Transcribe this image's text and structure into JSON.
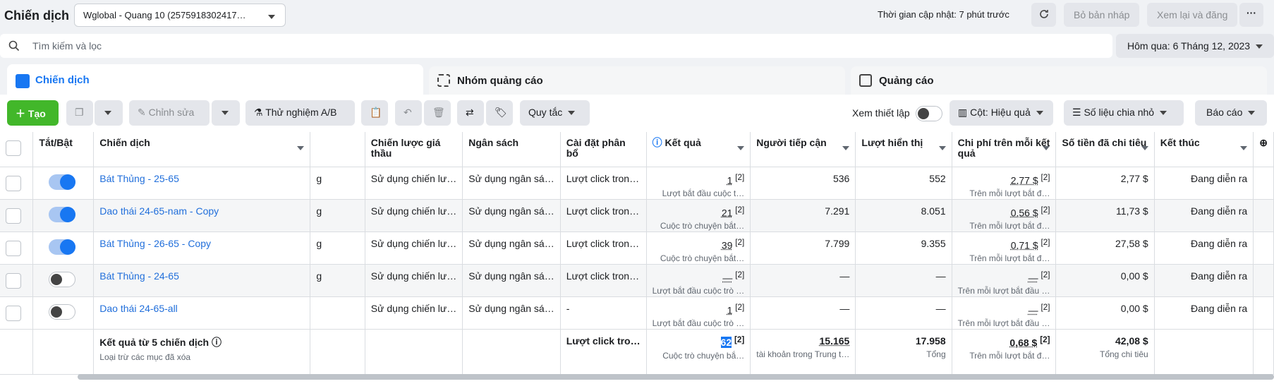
{
  "header": {
    "title": "Chiến dịch",
    "account": "Wglobal - Quang 10 (2575918302417…",
    "updated": "Thời gian cập nhật: 7 phút trước",
    "discard": "Bỏ bản nháp",
    "review": "Xem lại và đăng",
    "more": "···"
  },
  "search": {
    "placeholder": "Tìm kiếm và lọc"
  },
  "date": "Hôm qua: 6 Tháng 12, 2023",
  "tabs": [
    "Chiến dịch",
    "Nhóm quảng cáo",
    "Quảng cáo"
  ],
  "toolbar": {
    "create": "Tạo",
    "edit": "Chỉnh sửa",
    "ab": "Thử nghiệm A/B",
    "rules": "Quy tắc",
    "view_setup": "Xem thiết lập",
    "columns": "Cột: Hiệu quả",
    "breakdown": "Số liệu chia nhỏ",
    "reports": "Báo cáo"
  },
  "columns": [
    "Tắt/Bật",
    "Chiến dịch",
    "Chiến lược giá thầu",
    "Ngân sách",
    "Cài đặt phân bổ",
    "Kết quả",
    "Người tiếp cận",
    "Lượt hiển thị",
    "Chi phí trên mỗi kết quả",
    "Số tiền đã chi tiêu",
    "Kết thúc"
  ],
  "rows": [
    {
      "on": true,
      "name": "Bát Thủng - 25-65",
      "g": "g",
      "bid": "Sử dụng chiến lư…",
      "budget": "Sử dụng ngân sá…",
      "attr": "Lượt click tron…",
      "result": "1",
      "result_sub": "Lượt bắt đầu cuộc t…",
      "reach": "536",
      "impr": "552",
      "cpr": "2,77 $",
      "cpr_sub": "Trên mỗi lượt bắt đ…",
      "spent": "2,77 $",
      "end": "Đang diễn ra"
    },
    {
      "on": true,
      "name": "Dao thái 24-65-nam - Copy",
      "g": "g",
      "bid": "Sử dụng chiến lư…",
      "budget": "Sử dụng ngân sá…",
      "attr": "Lượt click tron…",
      "result": "21",
      "result_sub": "Cuộc trò chuyện bắt…",
      "reach": "7.291",
      "impr": "8.051",
      "cpr": "0,56 $",
      "cpr_sub": "Trên mỗi lượt bắt đ…",
      "spent": "11,73 $",
      "end": "Đang diễn ra"
    },
    {
      "on": true,
      "name": "Bát Thủng - 26-65 - Copy",
      "g": "g",
      "bid": "Sử dụng chiến lư…",
      "budget": "Sử dụng ngân sá…",
      "attr": "Lượt click tron…",
      "result": "39",
      "result_sub": "Cuộc trò chuyện bắt…",
      "reach": "7.799",
      "impr": "9.355",
      "cpr": "0,71 $",
      "cpr_sub": "Trên mỗi lượt bắt đ…",
      "spent": "27,58 $",
      "end": "Đang diễn ra"
    },
    {
      "on": false,
      "name": "Bát Thủng - 24-65",
      "g": "g",
      "bid": "Sử dụng chiến lư…",
      "budget": "Sử dụng ngân sá…",
      "attr": "Lượt click tron…",
      "result": "—",
      "result_sub": "Lượt bắt đầu cuộc trò …",
      "reach": "—",
      "impr": "—",
      "cpr": "—",
      "cpr_sub": "Trên mỗi lượt bắt đầu …",
      "spent": "0,00 $",
      "end": "Đang diễn ra"
    },
    {
      "on": false,
      "name": "Dao thái 24-65-all",
      "g": "",
      "bid": "Sử dụng chiến lư…",
      "budget": "Sử dụng ngân sá…",
      "attr": "-",
      "result": "1",
      "result_sub": "Lượt bắt đầu cuộc trò …",
      "reach": "—",
      "impr": "—",
      "cpr": "—",
      "cpr_sub": "Trên mỗi lượt bắt đầu …",
      "spent": "0,00 $",
      "end": "Đang diễn ra"
    }
  ],
  "totals": {
    "label": "Kết quả từ 5 chiến dịch",
    "note": "Loại trừ các mục đã xóa",
    "attr": "Lượt click tro…",
    "result": "62",
    "result_sub": "Cuộc trò chuyện bắ…",
    "reach": "15.165",
    "reach_sub": "tài khoản trong Trung t…",
    "impr": "17.958",
    "impr_sub": "Tổng",
    "cpr": "0,68 $",
    "cpr_sub": "Trên mỗi lượt bắt đ…",
    "spent": "42,08 $",
    "spent_sub": "Tổng chi tiêu"
  },
  "footnote": "[2]"
}
